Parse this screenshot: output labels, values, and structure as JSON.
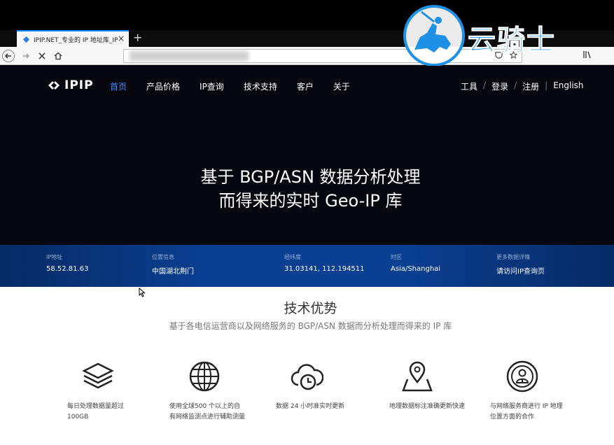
{
  "browser": {
    "tab_title": "IPIP.NET_专业的 IP 地址库_IPIP",
    "tab_close": "×",
    "new_tab": "+"
  },
  "watermark": {
    "text": "云骑士"
  },
  "site": {
    "logo_text": "IPIP",
    "nav": [
      {
        "label": "首页",
        "active": true
      },
      {
        "label": "产品价格",
        "active": false
      },
      {
        "label": "IP查询",
        "active": false
      },
      {
        "label": "技术支持",
        "active": false
      },
      {
        "label": "客户",
        "active": false
      },
      {
        "label": "关于",
        "active": false
      }
    ],
    "right_nav": [
      "工具",
      "登录",
      "注册",
      "English"
    ],
    "hero_line1": "基于 BGP/ASN 数据分析处理",
    "hero_line2": "而得来的实时 Geo-IP 库",
    "info": [
      {
        "label": "IP地址",
        "value": "58.52.81.63"
      },
      {
        "label": "位置信息",
        "value": "中国湖北荆门"
      },
      {
        "label": "经纬度",
        "value": "31.03141, 112.194511"
      },
      {
        "label": "时区",
        "value": "Asia/Shanghai"
      },
      {
        "label": "更多数据详情",
        "value": "请访问IP查询页"
      }
    ],
    "section_title": "技术优势",
    "section_subtitle": "基于各电信运营商以及网络服务的 BGP/ASN 数据而分析处理而得来的 IP 库",
    "features": [
      {
        "icon": "layers-icon",
        "text": "每日处理数据量超过 100GB"
      },
      {
        "icon": "globe-icon",
        "text": "使用全球500 个以上的自有网络监测点进行辅助测量"
      },
      {
        "icon": "cloud-clock-icon",
        "text": "数据 24 小时准实时更新"
      },
      {
        "icon": "map-pin-icon",
        "text": "地理数据标注准确更新快速"
      },
      {
        "icon": "user-badge-icon",
        "text": "与网络服务商进行 IP 地理位置方面的合作"
      }
    ]
  }
}
